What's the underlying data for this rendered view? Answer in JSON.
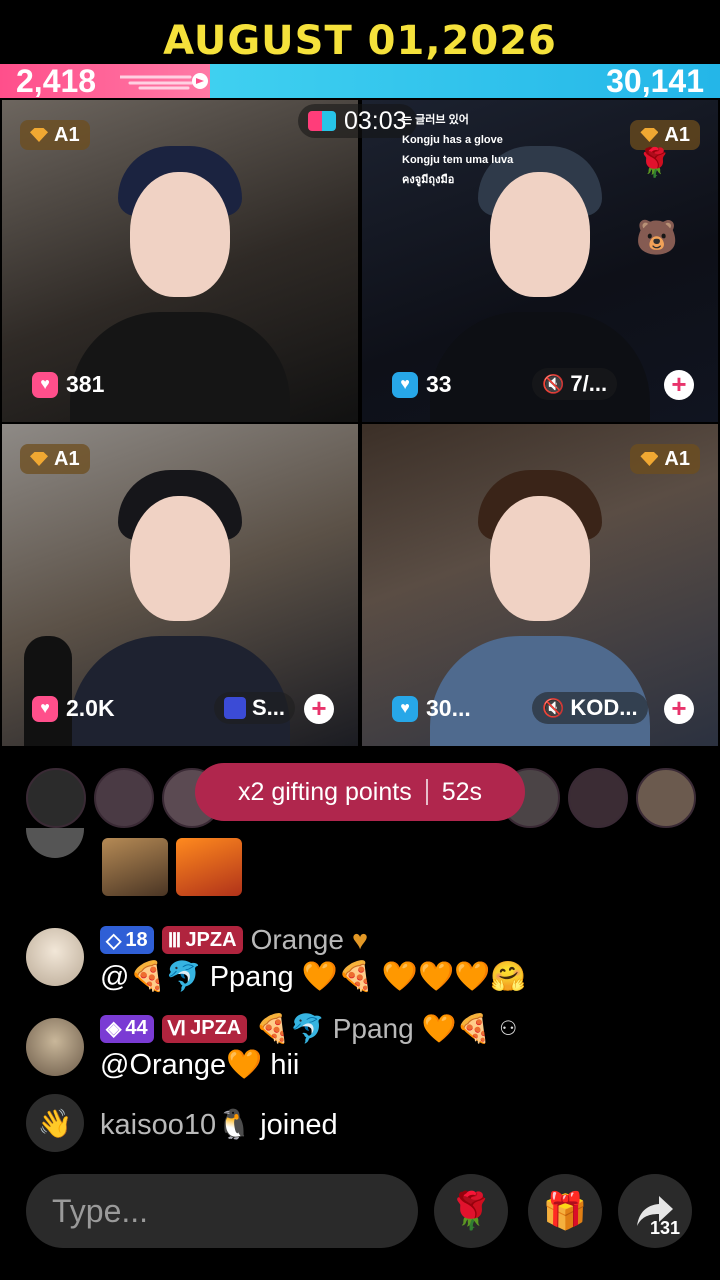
{
  "banner": {
    "date": "AUGUST 01,2026"
  },
  "battle": {
    "left_score": "2,418",
    "right_score": "30,141",
    "timer": "03:03",
    "caption_lines": [
      "는 글러브 있어",
      "Kongju has a glove",
      "Kongju tem uma luva",
      "คงจูมีถุงมือ"
    ]
  },
  "tiles": [
    {
      "rank": "A1",
      "gifts": "381",
      "gift_icon": "pink-gift-icon"
    },
    {
      "rank": "A1",
      "gifts": "33",
      "gift_icon": "blue-gift-icon",
      "guest_label": "7/...",
      "muted": true
    },
    {
      "rank": "A1",
      "gifts": "2.0K",
      "gift_icon": "pink-gift-icon",
      "guest_label": "S..."
    },
    {
      "rank": "A1",
      "gifts": "30...",
      "gift_icon": "blue-gift-icon",
      "guest_label": "KOD...",
      "muted": true
    }
  ],
  "gifting": {
    "label": "x2 gifting points",
    "time": "52s"
  },
  "chat": [
    {
      "level": "18",
      "fan_badge": "JPZA",
      "username": "Orange",
      "message": "@🍕🐬 Ppang 🧡🍕 🧡🧡🧡🤗"
    },
    {
      "level": "44",
      "fan_badge": "JPZA",
      "username": "🍕🐬 Ppang 🧡🍕",
      "message": "@Orange🧡 hii"
    }
  ],
  "join": {
    "username": "kaisoo10🐧",
    "action": "joined"
  },
  "input": {
    "placeholder": "Type..."
  },
  "actions": {
    "rose": "🌹",
    "gift": "🎁",
    "share_count": "131"
  },
  "colors": {
    "left_team": "#ff4f8b",
    "right_team": "#27c4e8",
    "banner": "#f5e13b",
    "gifting": "#b0264d"
  }
}
